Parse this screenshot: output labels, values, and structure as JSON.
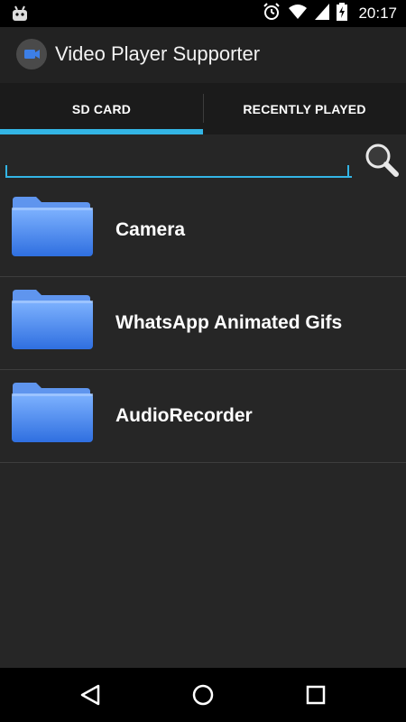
{
  "status_bar": {
    "time": "20:17",
    "icons": [
      "android-icon",
      "alarm-icon",
      "wifi-icon",
      "signal-icon",
      "battery-charging-icon"
    ]
  },
  "action_bar": {
    "title": "Video Player Supporter",
    "icon": "video-camera-icon"
  },
  "tabs": [
    {
      "label": "SD CARD",
      "selected": true
    },
    {
      "label": "RECENTLY PLAYED",
      "selected": false
    }
  ],
  "search": {
    "value": "",
    "placeholder": "",
    "button_icon": "magnifier-icon"
  },
  "folders": [
    {
      "label": "Camera",
      "icon": "folder-icon"
    },
    {
      "label": "WhatsApp Animated Gifs",
      "icon": "folder-icon"
    },
    {
      "label": "AudioRecorder",
      "icon": "folder-icon"
    }
  ],
  "nav_bar": {
    "buttons": [
      "back-icon",
      "home-icon",
      "recents-icon"
    ]
  },
  "colors": {
    "accent": "#33b5e5",
    "background": "#262626",
    "folder_blue": "#3d7fe6"
  }
}
